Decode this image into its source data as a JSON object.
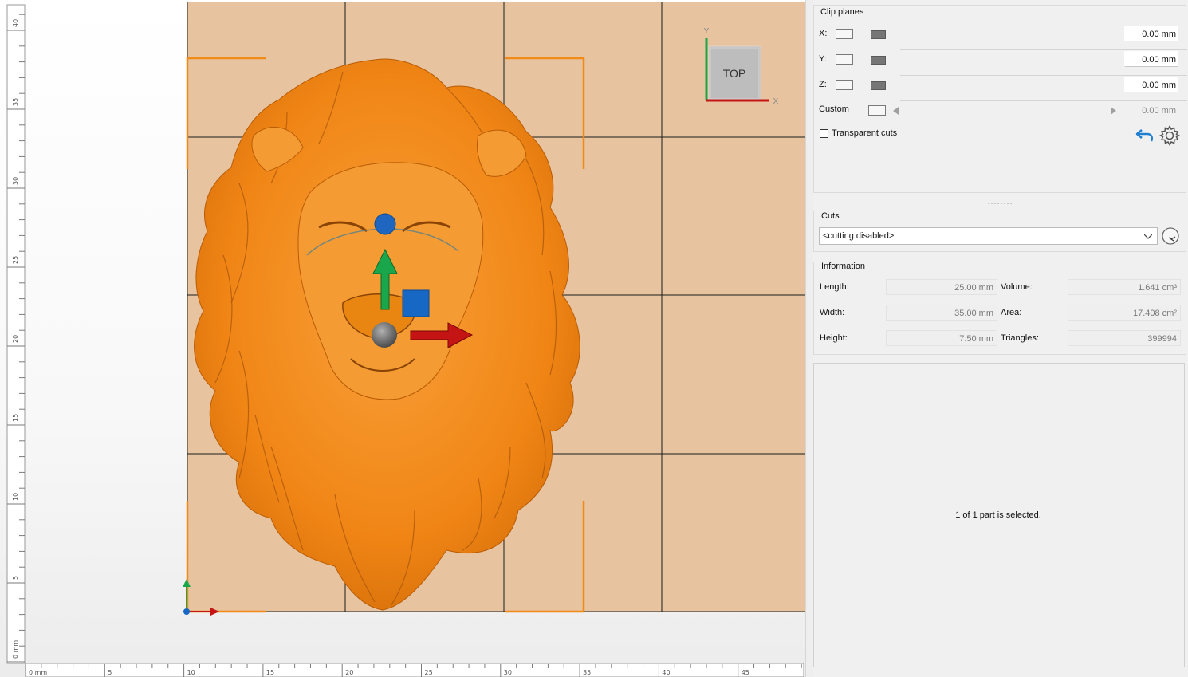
{
  "viewport": {
    "view_label": "TOP",
    "axis_labels": {
      "x": "X",
      "y": "Y"
    },
    "ruler_bottom": [
      "0 mm",
      "5",
      "10",
      "15",
      "20",
      "25",
      "30",
      "35",
      "40",
      "45"
    ],
    "ruler_left": [
      "40",
      "35",
      "30",
      "25",
      "20",
      "15",
      "10",
      "5",
      "0 mm"
    ],
    "model": "lion-head relief",
    "colors": {
      "model": "#f58a1c",
      "plate": "#e8c3a0",
      "bracket": "#f08a19"
    }
  },
  "clip_planes": {
    "title": "Clip planes",
    "rows": [
      {
        "label": "X:",
        "value": "0.00 mm"
      },
      {
        "label": "Y:",
        "value": "0.00 mm"
      },
      {
        "label": "Z:",
        "value": "0.00 mm"
      }
    ],
    "custom": {
      "label": "Custom",
      "value": "0.00 mm"
    },
    "transparent_cuts": "Transparent cuts",
    "icons": [
      "undo-icon",
      "gear-icon"
    ]
  },
  "cuts": {
    "title": "Cuts",
    "selected": "<cutting disabled>"
  },
  "information": {
    "title": "Information",
    "length_label": "Length:",
    "length": "25.00 mm",
    "width_label": "Width:",
    "width": "35.00 mm",
    "height_label": "Height:",
    "height": "7.50 mm",
    "volume_label": "Volume:",
    "volume": "1.641 cm³",
    "area_label": "Area:",
    "area": "17.408 cm²",
    "triangles_label": "Triangles:",
    "triangles": "399994"
  },
  "status": "1 of 1 part is selected."
}
